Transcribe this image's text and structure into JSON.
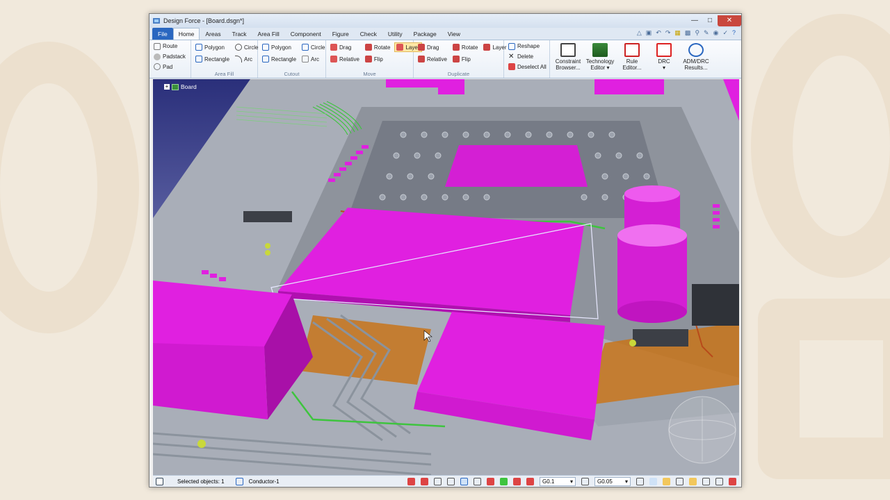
{
  "window": {
    "title": "Design Force - [Board.dsgn*]"
  },
  "tabs": [
    "File",
    "Home",
    "Areas",
    "Track",
    "Area Fill",
    "Component",
    "Figure",
    "Check",
    "Utility",
    "Package",
    "View"
  ],
  "ribbon": {
    "route": {
      "route": "Route",
      "padstack": "Padstack",
      "pad": "Pad"
    },
    "area_fill": {
      "polygon": "Polygon",
      "circle": "Circle",
      "rectangle": "Rectangle",
      "arc": "Arc",
      "label": "Area Fill"
    },
    "cutout": {
      "polygon": "Polygon",
      "circle": "Circle",
      "rectangle": "Rectangle",
      "arc": "Arc",
      "label": "Cutout"
    },
    "move": {
      "drag": "Drag",
      "rotate": "Rotate",
      "layer": "Layer",
      "relative": "Relative",
      "flip": "Flip",
      "label": "Move"
    },
    "duplicate": {
      "drag": "Drag",
      "rotate": "Rotate",
      "layer": "Layer",
      "relative": "Relative",
      "flip": "Flip",
      "label": "Duplicate"
    },
    "edit": {
      "reshape": "Reshape",
      "delete": "Delete",
      "deselect_all": "Deselect All"
    },
    "tools": [
      {
        "line1": "Constraint",
        "line2": "Browser..."
      },
      {
        "line1": "Technology",
        "line2": "Editor ▾"
      },
      {
        "line1": "Rule",
        "line2": "Editor..."
      },
      {
        "line1": "DRC",
        "line2": "▾"
      },
      {
        "line1": "ADM/DRC",
        "line2": "Results..."
      }
    ]
  },
  "tree": {
    "root": "Board"
  },
  "status": {
    "selected": "Selected objects: 1",
    "conductor": "Conductor-1",
    "grid1": "G0.1",
    "grid2": "G0.05"
  },
  "colors": {
    "component": "#e020e0",
    "board": "#b8bec8",
    "copper": "#c8741a",
    "sky": "#2a2f7a"
  }
}
